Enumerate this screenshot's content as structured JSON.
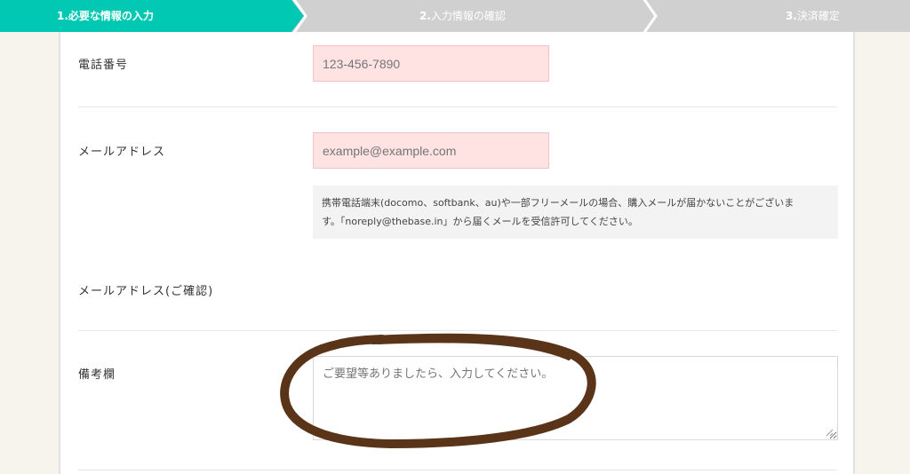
{
  "steps": [
    {
      "number": "1.",
      "label": "必要な情報の入力"
    },
    {
      "number": "2.",
      "label": "入力情報の確認"
    },
    {
      "number": "3.",
      "label": "決済確定"
    }
  ],
  "colors": {
    "active_step": "#00c8b3",
    "inactive_step": "#d0d0d0",
    "annotation": "#5a3418",
    "input_bg": "#ffe2e2"
  },
  "form": {
    "phone": {
      "label": "電話番号",
      "placeholder": "123-456-7890"
    },
    "email": {
      "label": "メールアドレス",
      "placeholder": "example@example.com",
      "notice_line1": "携帯電話端末(docomo、softbank、au)や一部フリーメールの場合、購入メールが届かないことがございま",
      "notice_line2": "す。「noreply@thebase.in」から届くメールを受信許可してください。"
    },
    "email_confirm": {
      "label": "メールアドレス(ご確認)"
    },
    "notes": {
      "label": "備考欄",
      "placeholder": "ご要望等ありましたら、入力してください。"
    }
  }
}
